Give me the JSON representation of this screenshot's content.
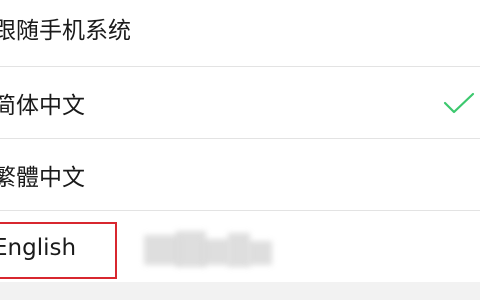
{
  "language_options": [
    {
      "label": "跟随手机系统",
      "selected": false
    },
    {
      "label": "简体中文",
      "selected": true
    },
    {
      "label": "繁體中文",
      "selected": false
    },
    {
      "label": "English",
      "selected": false
    }
  ],
  "check_icon": {
    "name": "checkmark-icon",
    "color": "#3cc86e"
  },
  "highlight_color": "#d8272f"
}
